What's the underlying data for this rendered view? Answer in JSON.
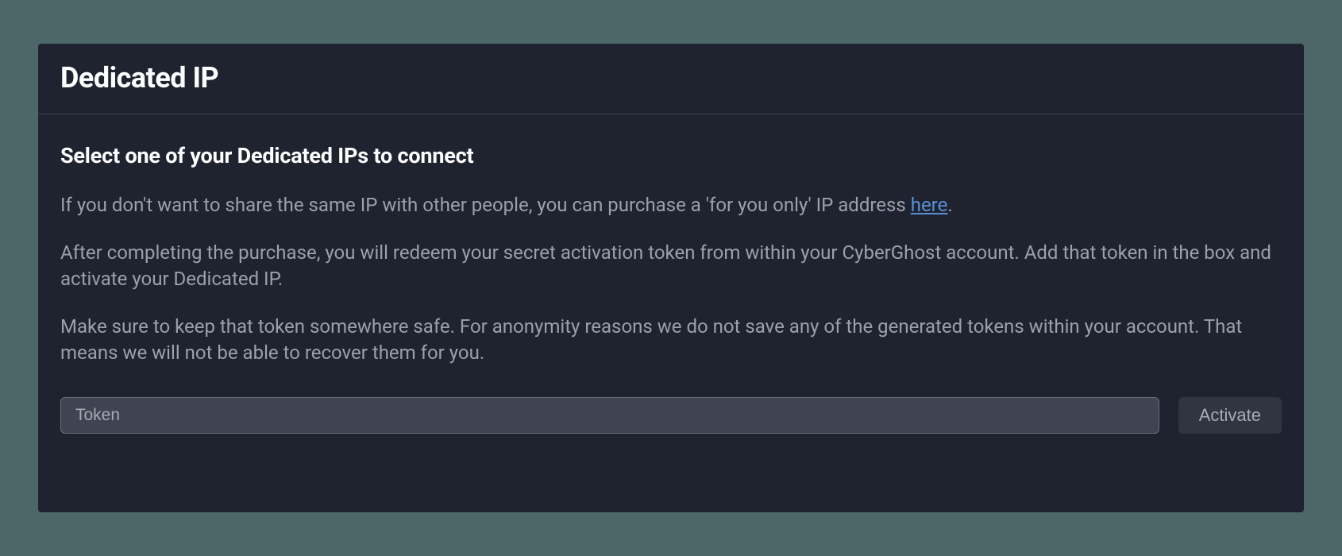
{
  "header": {
    "title": "Dedicated IP"
  },
  "main": {
    "subtitle": "Select one of your Dedicated IPs to connect",
    "paragraph1_before": "If you don't want to share the same IP with other people, you can purchase a 'for you only' IP address ",
    "paragraph1_link": "here",
    "paragraph1_after": ".",
    "paragraph2": "After completing the purchase, you will redeem your secret activation token from within your CyberGhost account. Add that token in the box and activate your Dedicated IP.",
    "paragraph3": "Make sure to keep that token somewhere safe. For anonymity reasons we do not save any of the generated tokens within your account. That means we will not be able to recover them for you.",
    "token_placeholder": "Token",
    "token_value": "",
    "activate_label": "Activate"
  }
}
